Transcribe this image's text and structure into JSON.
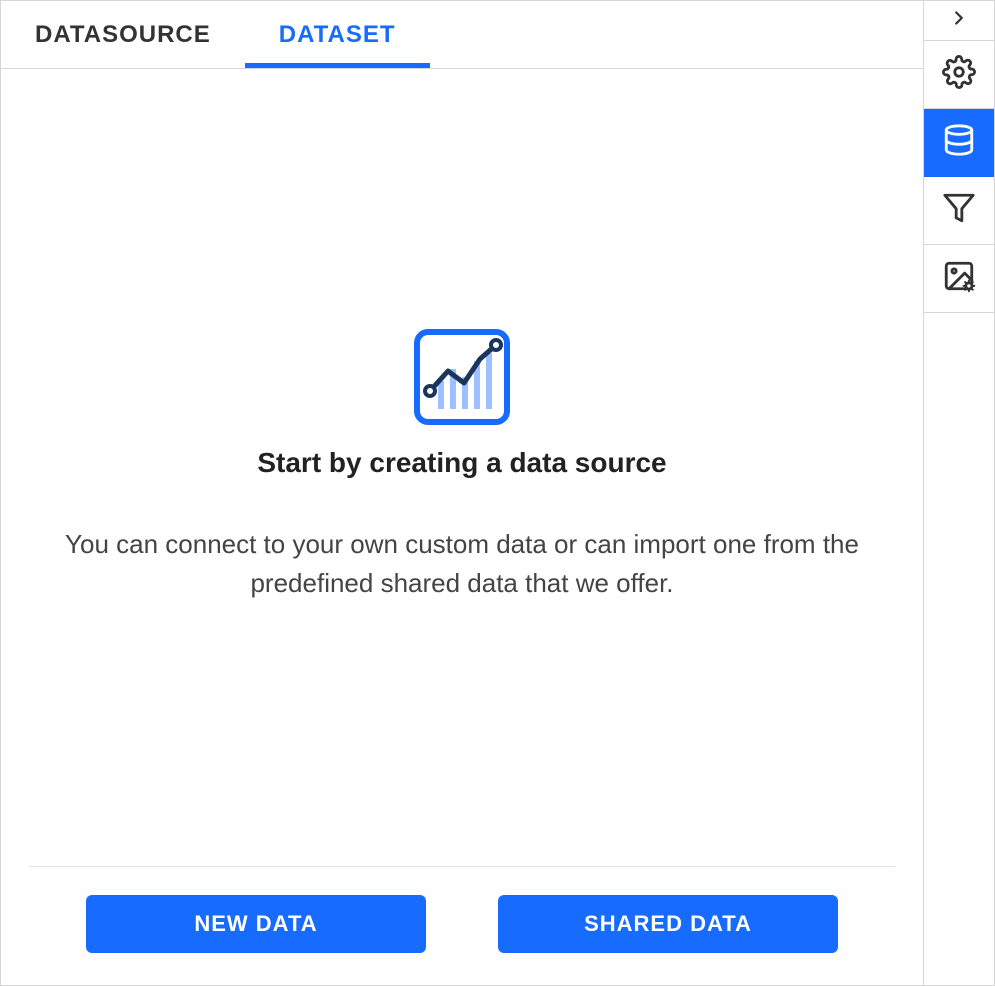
{
  "tabs": {
    "datasource": "DATASOURCE",
    "dataset": "DATASET",
    "active": "dataset"
  },
  "empty_state": {
    "title": "Start by creating a data source",
    "description": "You can connect to your own custom data or can import one from the predefined shared data that we offer."
  },
  "buttons": {
    "new_data": "NEW DATA",
    "shared_data": "SHARED DATA"
  },
  "sidebar": {
    "items": [
      {
        "name": "collapse",
        "icon": "chevron-right",
        "active": false
      },
      {
        "name": "settings",
        "icon": "gear",
        "active": false
      },
      {
        "name": "data",
        "icon": "database",
        "active": true
      },
      {
        "name": "filter",
        "icon": "funnel",
        "active": false
      },
      {
        "name": "image",
        "icon": "picture-gear",
        "active": false
      }
    ]
  },
  "colors": {
    "accent": "#176bff",
    "text": "#333333",
    "border": "#d6d6d6"
  }
}
